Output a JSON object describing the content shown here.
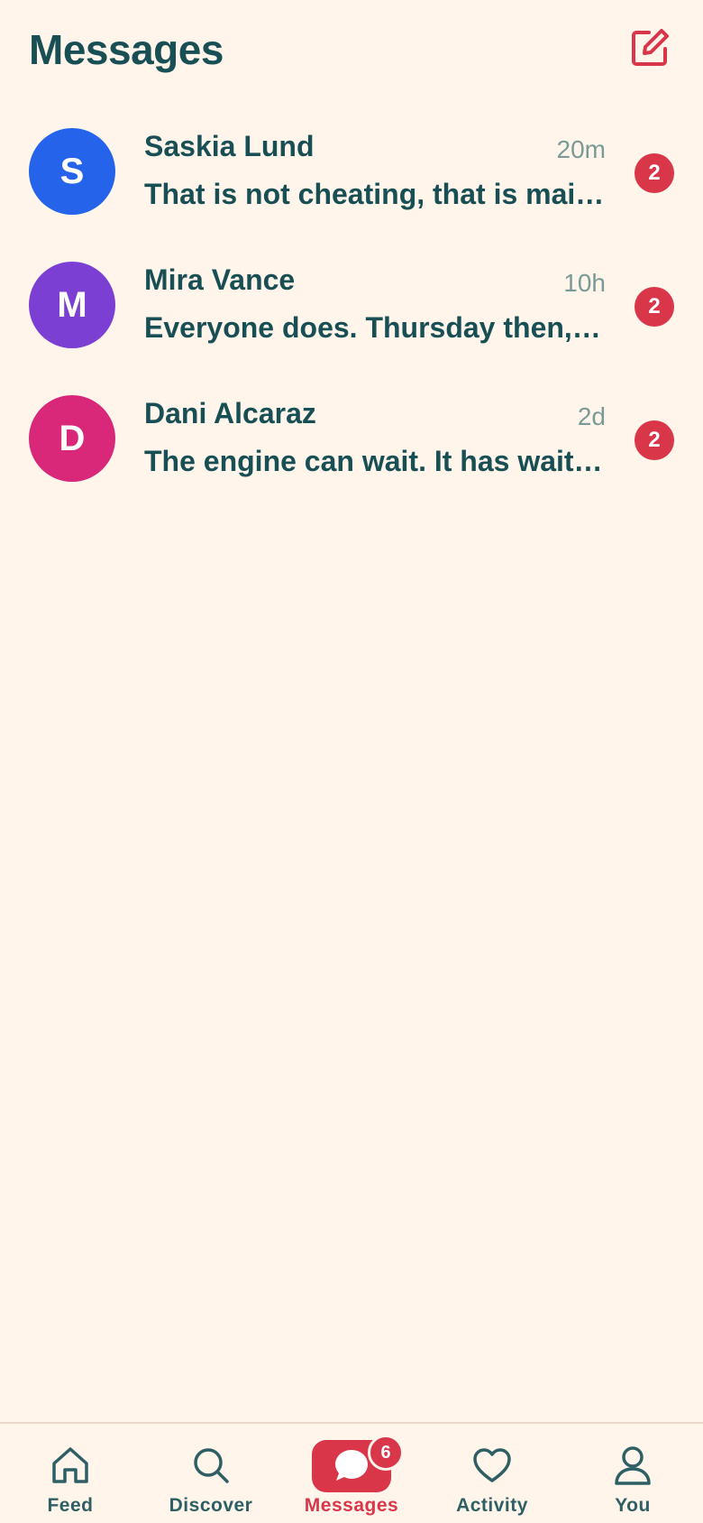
{
  "header": {
    "title": "Messages",
    "compose_icon": "compose-icon"
  },
  "conversations": [
    {
      "initial": "S",
      "name": "Saskia Lund",
      "time": "20m",
      "preview": "That is not cheating, that is maintenance.",
      "unread": "2",
      "avatar_color": "#2563eb"
    },
    {
      "initial": "M",
      "name": "Mira Vance",
      "time": "10h",
      "preview": "Everyone does. Thursday then, at seven.",
      "unread": "2",
      "avatar_color": "#7b3fd3"
    },
    {
      "initial": "D",
      "name": "Dani Alcaraz",
      "time": "2d",
      "preview": "The engine can wait. It has waited this long.",
      "unread": "2",
      "avatar_color": "#d9277a"
    }
  ],
  "tabbar": {
    "tabs": [
      {
        "label": "Feed",
        "icon": "home-icon"
      },
      {
        "label": "Discover",
        "icon": "search-icon"
      },
      {
        "label": "Messages",
        "icon": "chat-bubble-icon",
        "badge": "6",
        "active": true
      },
      {
        "label": "Activity",
        "icon": "heart-icon"
      },
      {
        "label": "You",
        "icon": "person-icon"
      }
    ]
  },
  "colors": {
    "background": "#fff5eb",
    "text_primary": "#184f55",
    "text_muted": "#7a9a98",
    "accent": "#d9364a"
  }
}
